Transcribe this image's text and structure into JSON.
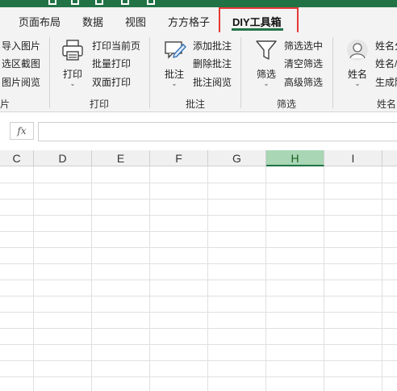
{
  "tabs": [
    {
      "label": "页面布局"
    },
    {
      "label": "数据"
    },
    {
      "label": "视图"
    },
    {
      "label": "方方格子"
    },
    {
      "label": "DIY工具箱"
    }
  ],
  "active_tab": "DIY工具箱",
  "ribbon": {
    "group_image": {
      "items": [
        "导入图片",
        "选区截图",
        "图片阅览"
      ],
      "label": "图片"
    },
    "group_print": {
      "big_button": "打印",
      "items": [
        "打印当前页",
        "批量打印",
        "双面打印"
      ],
      "label": "打印"
    },
    "group_comment": {
      "big_button": "批注",
      "items": [
        "添加批注",
        "删除批注",
        "批注阅览"
      ],
      "label": "批注"
    },
    "group_filter": {
      "big_button": "筛选",
      "items": [
        "筛选选中",
        "清空筛选",
        "高级筛选"
      ],
      "label": "筛选"
    },
    "group_name": {
      "big_button": "姓名",
      "items": [
        "姓名分",
        "姓名/",
        "生成随"
      ],
      "label": "姓名"
    }
  },
  "formula_bar": {
    "fx_label": "fx",
    "value": ""
  },
  "columns": [
    "C",
    "D",
    "E",
    "F",
    "G",
    "H",
    "I"
  ],
  "selected_column": "H",
  "colors": {
    "brand_green": "#217346",
    "highlight_red": "#e53935",
    "selected_header": "#a9d6b4"
  }
}
